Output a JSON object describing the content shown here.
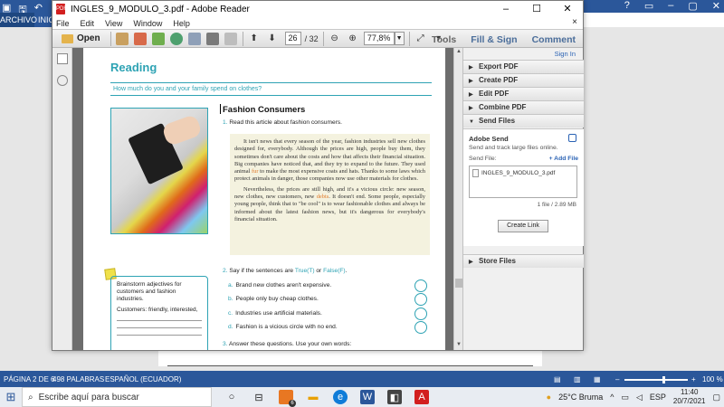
{
  "word": {
    "archivo_tab": "ARCHIVO",
    "inicio_tab": "INIC",
    "status": {
      "page": "PÁGINA 2 DE 6",
      "words": "498 PALABRAS",
      "language": "ESPAÑOL (ECUADOR)",
      "zoom": "100 %"
    }
  },
  "taskbar": {
    "search_placeholder": "Escribe aquí para buscar",
    "weather": "25°C  Bruma",
    "language": "ESP",
    "time": "11:40",
    "date": "20/7/2021",
    "edge_badge": "6"
  },
  "reader": {
    "title": "INGLES_9_MODULO_3.pdf - Adobe Reader",
    "menu": [
      "File",
      "Edit",
      "View",
      "Window",
      "Help"
    ],
    "toolbar": {
      "open_label": "Open",
      "page_current": "26",
      "page_total": "/ 32",
      "zoom": "77,8%",
      "tools_label": "Tools",
      "fill_sign_label": "Fill & Sign",
      "comment_label": "Comment"
    },
    "pane": {
      "sign_in": "Sign In",
      "items": [
        "Export PDF",
        "Create PDF",
        "Edit PDF",
        "Combine PDF",
        "Send Files",
        "Store Files"
      ],
      "send": {
        "title": "Adobe Send",
        "desc": "Send and track large files online.",
        "file_label": "Send File:",
        "add_file": "+ Add File",
        "file_name": "INGLES_9_MODULO_3.pdf",
        "count": "1 file / 2.89 MB",
        "create_link": "Create Link"
      }
    }
  },
  "pdf": {
    "section": "Reading",
    "question": "How much do you and your family spend on clothes?",
    "article_title": "Fashion Consumers",
    "inst1_num": "1.",
    "inst1": "Read this article about fashion consumers.",
    "para1_a": "It isn't news that every season of the year, fashion industries sell new clothes designed for, everybody. Although the prices are high, people buy them, they sometimes don't care about the costs and how that affects their financial situation. Big companies have noticed that, and they try to expand to the future. They used animal ",
    "para1_fur": "fur",
    "para1_b": " to make the most expensive coats and hats. Thanks to some laws which protect animals in danger, those companies now use other materials for clothes.",
    "para2_a": "Nevertheless, the prices are still high, and it's a vicious circle: new season, new clothes, new customers, new ",
    "para2_debts": "debts",
    "para2_b": ". It doesn't end. Some people, especially young people, think that to \"be cool\" is to wear fashionable clothes and always be informed about the latest fashion news, but it's dangerous for everybody's financial situation.",
    "inst2_num": "2.",
    "inst2_a": "Say if the sentences are ",
    "inst2_true": "True(T)",
    "inst2_or": " or ",
    "inst2_false": "False(F)",
    "inst2_end": ".",
    "tf": [
      {
        "letter": "a.",
        "text": "Brand new clothes aren't expensive."
      },
      {
        "letter": "b.",
        "text": "People only buy cheap clothes."
      },
      {
        "letter": "c.",
        "text": "Industries use artificial materials."
      },
      {
        "letter": "d.",
        "text": "Fashion is a vicious circle with no end."
      }
    ],
    "inst3_num": "3.",
    "inst3": "Answer these questions. Use your own words:",
    "brainstorm": "Brainstorm adjectives for customers and fashion industries.",
    "customers": "Customers: friendly, interested,"
  },
  "colors": {
    "word_blue": "#2b579a",
    "pdf_teal": "#2ea3b4",
    "link_blue": "#2a62b4"
  }
}
